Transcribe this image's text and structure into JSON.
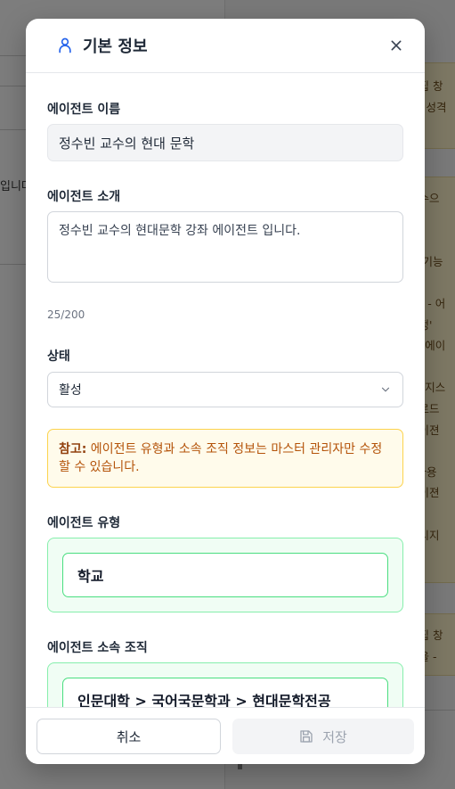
{
  "background": {
    "left_fragment": "입니다",
    "card1_lines": [
      "편집 창",
      "ㅏ, 성격",
      "."
    ],
    "card2_lines": [
      "교수으",
      "다!",
      "",
      "음 기능",
      "",
      "집\" - 어",
      "설정'",
      "\" - 에이",
      "",
      "\" - 지스",
      "업로드",
      "에이젼",
      "",
      "- 사용",
      "에이젼",
      "",
      "메시지"
    ],
    "card3_lines": [
      "편집 창",
      "등을 -"
    ]
  },
  "modal": {
    "title": "기본 정보",
    "header_icon": "user-icon",
    "name_label": "에이전트 이름",
    "name_value": "정수빈 교수의 현대 문학",
    "intro_label": "에이전트 소개",
    "intro_value": "정수빈 교수의 현대문학 강좌 에이전트 입니다.",
    "intro_counter": "25/200",
    "status_label": "상태",
    "status_value": "활성",
    "notice_bold": "참고:",
    "notice_text": " 에이전트 유형과 소속 조직 정보는 마스터 관리자만 수정할 수 있습니다.",
    "type_label": "에이전트 유형",
    "type_value": "학교",
    "org_label": "에이전트 소속 조직",
    "org_value": "인문대학 > 국어국문학과 > 현대문학전공"
  },
  "footer": {
    "cancel_label": "취소",
    "save_label": "저장",
    "save_icon": "save-icon"
  },
  "colors": {
    "accent": "#2563eb",
    "notice_text": "#b45309",
    "green_border": "#4ade80"
  }
}
